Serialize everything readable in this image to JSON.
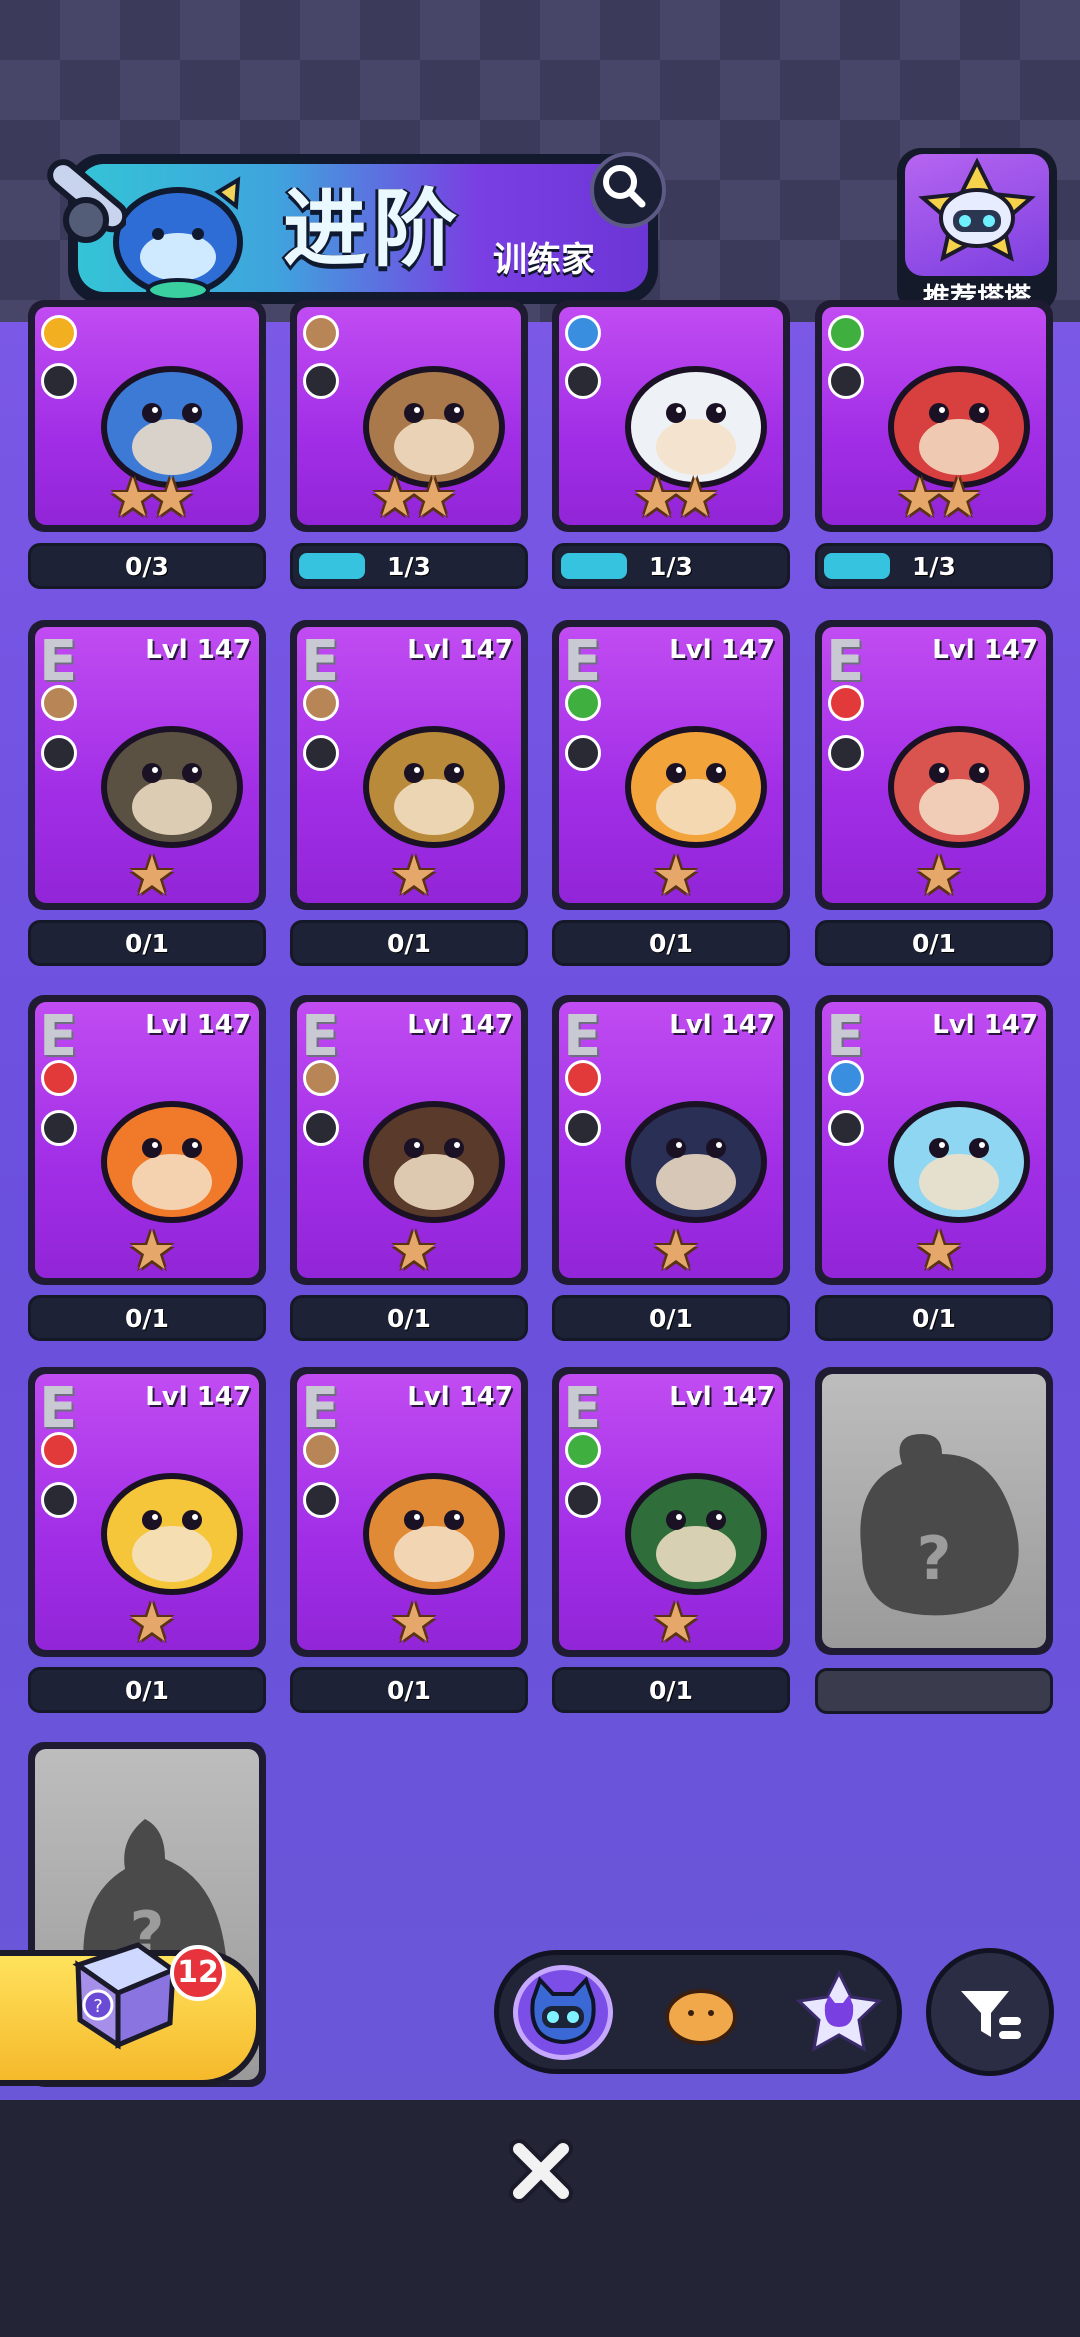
{
  "header": {
    "title": "进阶",
    "subtitle": "训练家",
    "recommend_label": "推荐塔塔"
  },
  "colors": {
    "card_purple": "#a12ee6",
    "progress_cyan": "#36c3df",
    "bar_dark": "#1e2236",
    "bg_purple": "#7b58e6",
    "fire": "#e23a3a",
    "earth": "#b88656",
    "grass": "#3fb040",
    "water": "#3a8ee0",
    "electric": "#f2b020"
  },
  "cards_row0": [
    {
      "stars": "★★",
      "progress": "0/3",
      "fill": 0,
      "element": "electric",
      "role": "eye-icon"
    },
    {
      "stars": "★★",
      "progress": "1/3",
      "fill": 0.33,
      "element": "earth",
      "role": "shield-icon"
    },
    {
      "stars": "★★",
      "progress": "1/3",
      "fill": 0.33,
      "element": "water",
      "role": "shield-icon"
    },
    {
      "stars": "★★",
      "progress": "1/3",
      "fill": 0.33,
      "element": "grass",
      "role": "sword-icon"
    }
  ],
  "cards": [
    {
      "rank": "E",
      "level": "Lvl 147",
      "stars": "★",
      "progress": "0/1",
      "element": "earth",
      "role": "kick-icon",
      "color": "#5b5142"
    },
    {
      "rank": "E",
      "level": "Lvl 147",
      "stars": "★",
      "progress": "0/1",
      "element": "earth",
      "role": "kick-icon",
      "color": "#b88a3a"
    },
    {
      "rank": "E",
      "level": "Lvl 147",
      "stars": "★",
      "progress": "0/1",
      "element": "grass",
      "role": "plus-icon",
      "color": "#f2a33a"
    },
    {
      "rank": "E",
      "level": "Lvl 147",
      "stars": "★",
      "progress": "0/1",
      "element": "fire",
      "role": "plus-icon",
      "color": "#d9534f"
    },
    {
      "rank": "E",
      "level": "Lvl 147",
      "stars": "★",
      "progress": "0/1",
      "element": "fire",
      "role": "eye-icon",
      "color": "#f07a2a"
    },
    {
      "rank": "E",
      "level": "Lvl 147",
      "stars": "★",
      "progress": "0/1",
      "element": "earth",
      "role": "sword-icon",
      "color": "#5a3a2a"
    },
    {
      "rank": "E",
      "level": "Lvl 147",
      "stars": "★",
      "progress": "0/1",
      "element": "fire",
      "role": "sword-icon",
      "color": "#2a2f55"
    },
    {
      "rank": "E",
      "level": "Lvl 147",
      "stars": "★",
      "progress": "0/1",
      "element": "water",
      "role": "potion-icon",
      "color": "#8fd6f2"
    },
    {
      "rank": "E",
      "level": "Lvl 147",
      "stars": "★",
      "progress": "0/1",
      "element": "fire",
      "role": "shield-icon",
      "color": "#f5c53a"
    },
    {
      "rank": "E",
      "level": "Lvl 147",
      "stars": "★",
      "progress": "0/1",
      "element": "earth",
      "role": "kick-icon",
      "color": "#e08a35"
    },
    {
      "rank": "E",
      "level": "Lvl 147",
      "stars": "★",
      "progress": "0/1",
      "element": "grass",
      "role": "potion-icon",
      "color": "#2f6e3a"
    }
  ],
  "locked": {
    "mark": "?"
  },
  "chest": {
    "count": "12"
  },
  "tabs": [
    "cat-icon",
    "bread-icon",
    "star-cat-icon"
  ]
}
